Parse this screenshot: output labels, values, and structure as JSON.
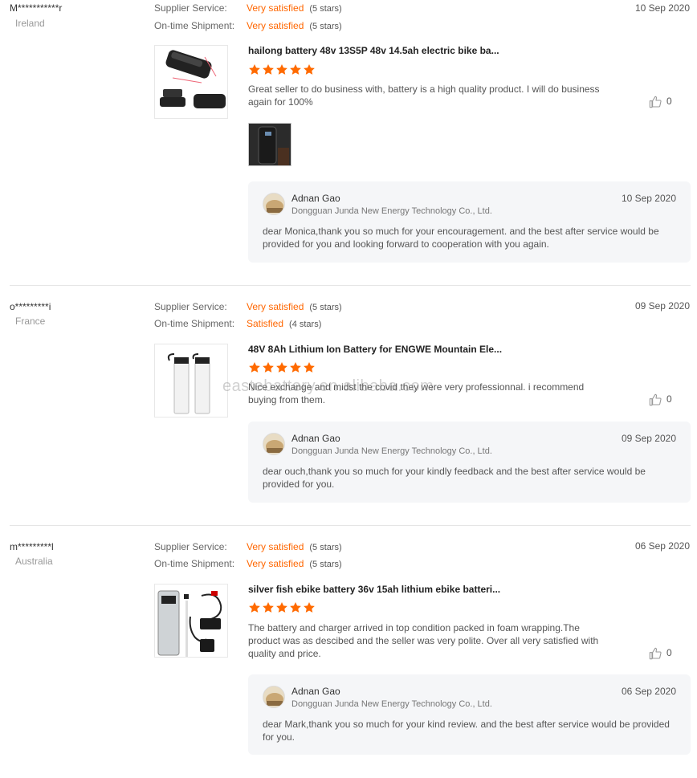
{
  "colors": {
    "accent": "#ff6600",
    "star": "#ff6a00",
    "divider": "#e5e5e5",
    "reply_bg": "#f5f6f8"
  },
  "labels": {
    "supplier_service": "Supplier Service:",
    "ontime_shipment": "On-time Shipment:"
  },
  "reviews": [
    {
      "buyer": "M***********r",
      "country": "Ireland",
      "date": "10 Sep 2020",
      "supplier_value": "Very satisfied",
      "supplier_stars": "(5 stars)",
      "shipment_value": "Very satisfied",
      "shipment_stars": "(5 stars)",
      "product_title": "hailong battery 48v 13S5P 48v 14.5ah electric bike ba...",
      "rating": 5,
      "text": "Great seller to do business with, battery is a high quality product. I will do business again for 100%",
      "likes": "0",
      "reply": {
        "name": "Adnan Gao",
        "company": "Dongguan Junda New Energy Technology Co., Ltd.",
        "date": "10 Sep 2020",
        "text": "dear Monica,thank you so much for your encouragement. and the best after service would be provided for you and looking forward to cooperation with you again."
      }
    },
    {
      "buyer": "o*********i",
      "country": "France",
      "date": "09 Sep 2020",
      "supplier_value": "Very satisfied",
      "supplier_stars": "(5 stars)",
      "shipment_value": "Satisfied",
      "shipment_stars": "(4 stars)",
      "product_title": "48V 8Ah Lithium Ion Battery for ENGWE Mountain Ele...",
      "rating": 5,
      "text": "Nice exchange and midst the covid they were very professionnal. i recommend buying from them.",
      "likes": "0",
      "reply": {
        "name": "Adnan Gao",
        "company": "Dongguan Junda New Energy Technology Co., Ltd.",
        "date": "09 Sep 2020",
        "text": "dear ouch,thank you so much for your kindly feedback and the best after service would be provided for you."
      }
    },
    {
      "buyer": "m*********l",
      "country": "Australia",
      "date": "06 Sep 2020",
      "supplier_value": "Very satisfied",
      "supplier_stars": "(5 stars)",
      "shipment_value": "Very satisfied",
      "shipment_stars": "(5 stars)",
      "product_title": "silver fish ebike battery 36v 15ah lithium ebike batteri...",
      "rating": 5,
      "text": "The battery and charger arrived in top condition packed in foam wrapping.The product was as descibed and the seller was very polite. Over all very satisfied with quality and price.",
      "likes": "0",
      "reply": {
        "name": "Adnan Gao",
        "company": "Dongguan Junda New Energy Technology Co., Ltd.",
        "date": "06 Sep 2020",
        "text": "dear Mark,thank you so much for your kind review. and the best after service would be provided for you."
      }
    }
  ],
  "watermark": "eastebattery.en.alibaba.com"
}
